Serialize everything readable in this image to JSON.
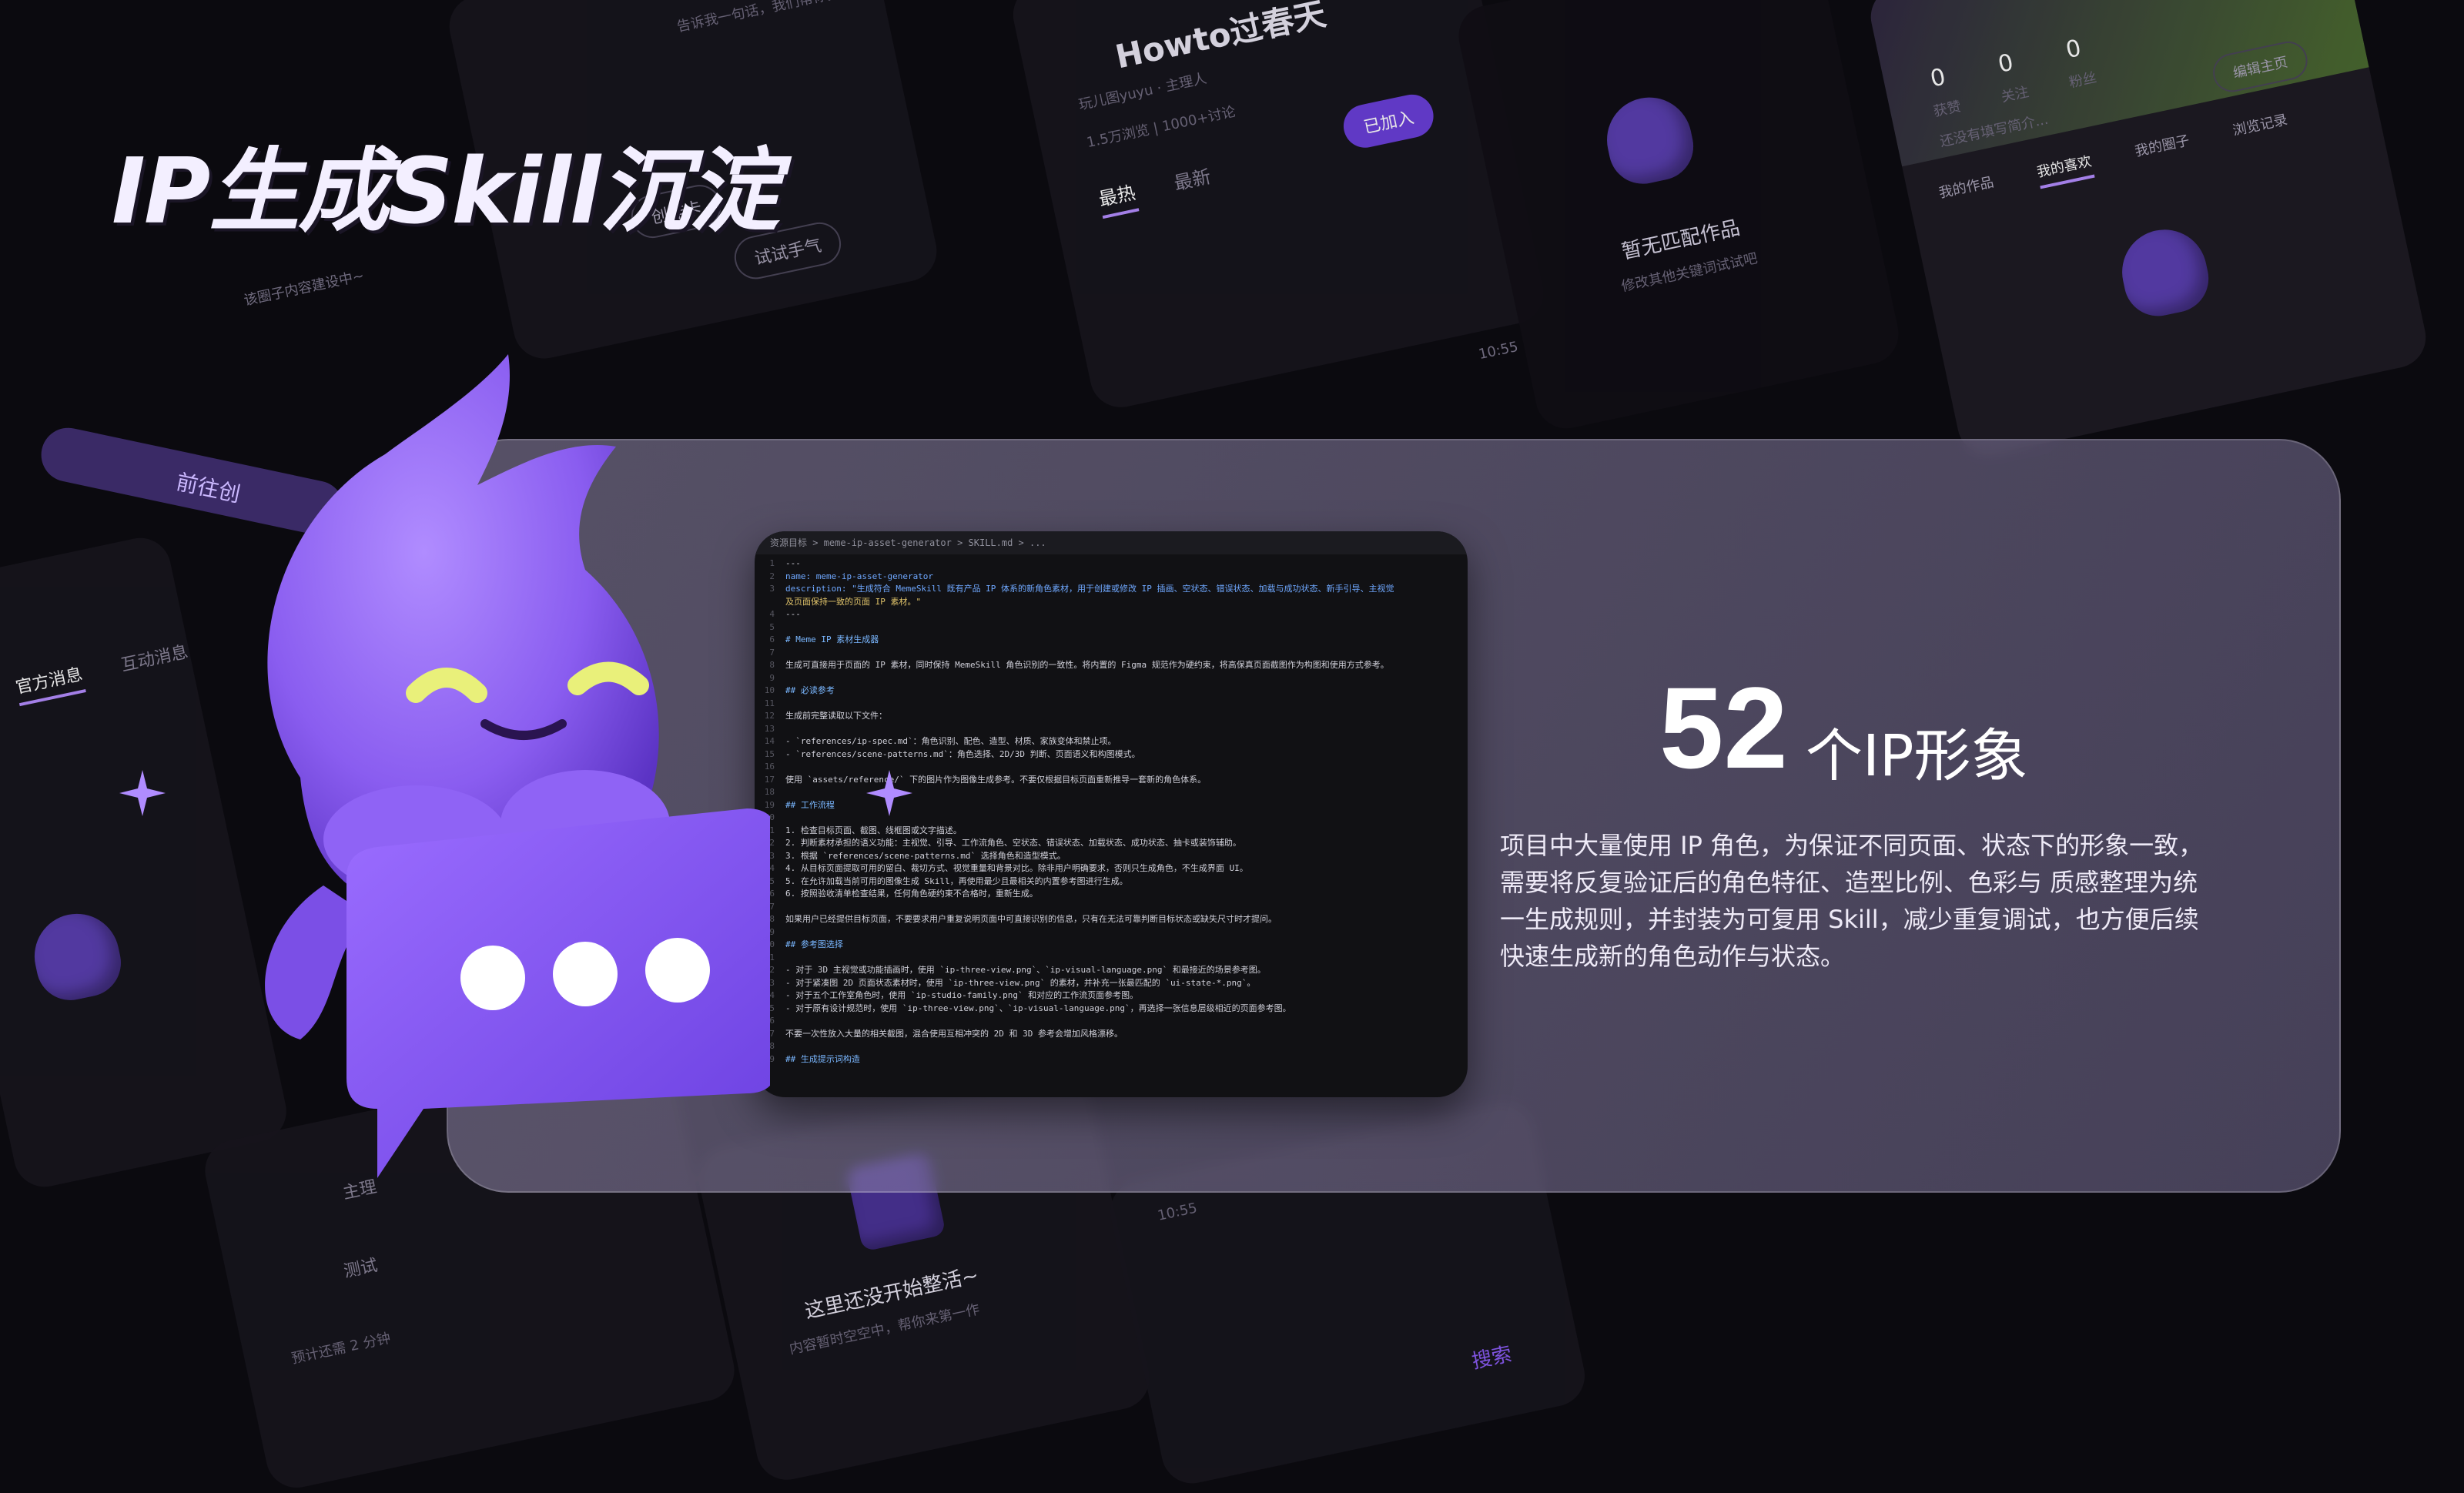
{
  "title": "IP生成Skill沉淀",
  "stat": {
    "number": "52",
    "unit": "个IP形象"
  },
  "description": "项目中大量使用 IP 角色，为保证不同页面、状态下的形象一致，需要将反复验证后的角色特征、造型比例、色彩与 质感整理为统一生成规则，并封装为可复用 Skill，减少重复调试，也方便后续快速生成新的角色动作与状态。",
  "colors": {
    "accent": "#8b5cf6",
    "card": "#8c84a6",
    "background": "#0b0a0f"
  },
  "background_ui": {
    "top_left_hint": "告诉我一句话，我们帮你把它变成可玩的小游戏",
    "create_card": "创作卡",
    "try_luck": "试试手气",
    "content_building": "该圈子内容建设中~",
    "go_to": "前往创",
    "circle_title": "Howto过春天",
    "circle_owner": "玩儿图yuyu · 主理人",
    "circle_stats": "1.5万浏览  |  1000+讨论",
    "tab_hot": "最热",
    "tab_new": "最新",
    "joined": "已加入",
    "no_match": "暂无匹配作品",
    "no_match_hint": "修改其他关键词试试吧",
    "profile_counts": [
      "0",
      "0",
      "0"
    ],
    "profile_labels": [
      "获赞",
      "关注",
      "粉丝"
    ],
    "profile_hint": "还没有填写简介...",
    "edit_profile": "编辑主页",
    "profile_tabs": [
      "我的作品",
      "我的喜欢",
      "我的圈子",
      "浏览记录"
    ],
    "not_started": "这里还没开始整活~",
    "not_started_hint": "内容暂时空空中，帮你来第一作",
    "time": "10:55",
    "msg_tabs": [
      "官方消息",
      "互动消息"
    ],
    "owner_label": "主理",
    "test_label": "测试",
    "wait_time": "预计还需 2 分钟",
    "search": "搜索"
  },
  "code": {
    "path": "资源目标 > meme-ip-asset-generator > SKILL.md > ...",
    "lines": [
      {
        "n": "1",
        "t": "---",
        "c": ""
      },
      {
        "n": "2",
        "t": "name: meme-ip-asset-generator",
        "c": "k"
      },
      {
        "n": "3",
        "t": "description: \"生成符合 MemeSkill 既有产品 IP 体系的新角色素材，用于创建或修改 IP 插画、空状态、错误状态、加载与成功状态、新手引导、主视觉",
        "c": "k"
      },
      {
        "n": "",
        "t": "及页面保持一致的页面 IP 素材。\"",
        "c": "s"
      },
      {
        "n": "4",
        "t": "---",
        "c": ""
      },
      {
        "n": "5",
        "t": "",
        "c": ""
      },
      {
        "n": "6",
        "t": "# Meme IP 素材生成器",
        "c": "h"
      },
      {
        "n": "7",
        "t": "",
        "c": ""
      },
      {
        "n": "8",
        "t": "生成可直接用于页面的 IP 素材，同时保持 MemeSkill 角色识别的一致性。将内置的 Figma 规范作为硬约束，将高保真页面截图作为构图和使用方式参考。",
        "c": ""
      },
      {
        "n": "9",
        "t": "",
        "c": ""
      },
      {
        "n": "10",
        "t": "## 必读参考",
        "c": "h"
      },
      {
        "n": "11",
        "t": "",
        "c": ""
      },
      {
        "n": "12",
        "t": "生成前完整读取以下文件：",
        "c": ""
      },
      {
        "n": "13",
        "t": "",
        "c": ""
      },
      {
        "n": "14",
        "t": "- `references/ip-spec.md`：角色识别、配色、造型、材质、家族变体和禁止项。",
        "c": ""
      },
      {
        "n": "15",
        "t": "- `references/scene-patterns.md`：角色选择、2D/3D 判断、页面语义和构图模式。",
        "c": ""
      },
      {
        "n": "16",
        "t": "",
        "c": ""
      },
      {
        "n": "17",
        "t": "使用 `assets/reference/` 下的图片作为图像生成参考。不要仅根据目标页面重新推导一套新的角色体系。",
        "c": ""
      },
      {
        "n": "18",
        "t": "",
        "c": ""
      },
      {
        "n": "19",
        "t": "## 工作流程",
        "c": "h"
      },
      {
        "n": "20",
        "t": "",
        "c": ""
      },
      {
        "n": "21",
        "t": "1. 检查目标页面、截图、线框图或文字描述。",
        "c": ""
      },
      {
        "n": "22",
        "t": "2. 判断素材承担的语义功能：主视觉、引导、工作流角色、空状态、错误状态、加载状态、成功状态、抽卡或装饰辅助。",
        "c": ""
      },
      {
        "n": "23",
        "t": "3. 根据 `references/scene-patterns.md` 选择角色和造型模式。",
        "c": ""
      },
      {
        "n": "24",
        "t": "4. 从目标页面提取可用的留白、裁切方式、视觉重量和背景对比。除非用户明确要求，否则只生成角色，不生成界面 UI。",
        "c": ""
      },
      {
        "n": "25",
        "t": "5. 在允许加载当前可用的图像生成 Skill，再使用最少且最相关的内置参考图进行生成。",
        "c": ""
      },
      {
        "n": "26",
        "t": "6. 按照验收清单检查结果，任何角色硬约束不合格时，重新生成。",
        "c": ""
      },
      {
        "n": "27",
        "t": "",
        "c": ""
      },
      {
        "n": "28",
        "t": "如果用户已经提供目标页面，不要要求用户重复说明页面中可直接识别的信息，只有在无法可靠判断目标状态或缺失尺寸时才提问。",
        "c": ""
      },
      {
        "n": "29",
        "t": "",
        "c": ""
      },
      {
        "n": "30",
        "t": "## 参考图选择",
        "c": "h"
      },
      {
        "n": "31",
        "t": "",
        "c": ""
      },
      {
        "n": "32",
        "t": "- 对于 3D 主视觉或功能插画时，使用 `ip-three-view.png`、`ip-visual-language.png` 和最接近的场景参考图。",
        "c": ""
      },
      {
        "n": "33",
        "t": "- 对于紧凑图 2D 页面状态素材时，使用 `ip-three-view.png` 的素材，并补充一张最匹配的 `ui-state-*.png`。",
        "c": ""
      },
      {
        "n": "34",
        "t": "- 对于五个工作室角色时，使用 `ip-studio-family.png` 和对应的工作流页面参考图。",
        "c": ""
      },
      {
        "n": "35",
        "t": "- 对于原有设计规范时，使用 `ip-three-view.png`、`ip-visual-language.png`，再选择一张信息层级相近的页面参考图。",
        "c": ""
      },
      {
        "n": "36",
        "t": "",
        "c": ""
      },
      {
        "n": "37",
        "t": "不要一次性放入大量的相关截图，混合使用互相冲突的 2D 和 3D 参考会增加风格漂移。",
        "c": ""
      },
      {
        "n": "38",
        "t": "",
        "c": ""
      },
      {
        "n": "39",
        "t": "## 生成提示词构造",
        "c": "h"
      }
    ]
  }
}
